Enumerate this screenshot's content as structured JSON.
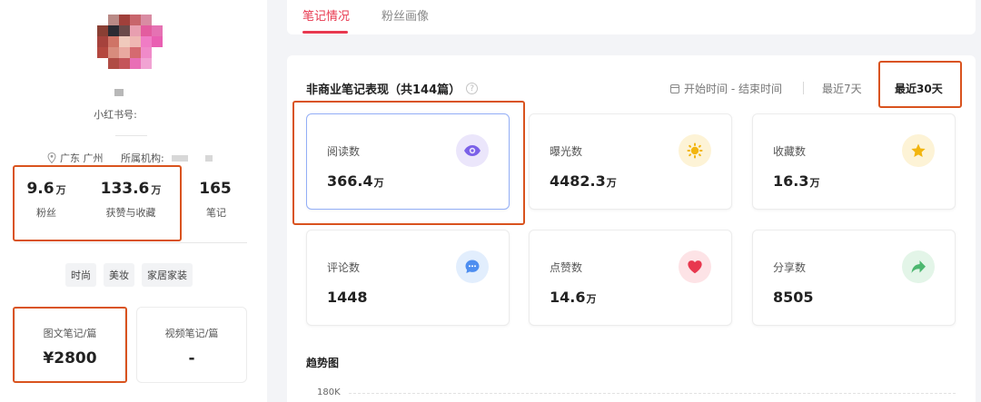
{
  "profile": {
    "red_id_label": "小红书号:",
    "location": "广东 广州",
    "org_label": "所属机构:",
    "stats": [
      {
        "value": "9.6",
        "unit": "万",
        "label": "粉丝"
      },
      {
        "value": "133.6",
        "unit": "万",
        "label": "获赞与收藏"
      },
      {
        "value": "165",
        "unit": "",
        "label": "笔记"
      }
    ],
    "tags": [
      "时尚",
      "美妆",
      "家居家装"
    ],
    "prices": [
      {
        "label": "图文笔记/篇",
        "value": "¥2800"
      },
      {
        "label": "视频笔记/篇",
        "value": "-"
      }
    ]
  },
  "tabs": [
    {
      "label": "笔记情况",
      "active": true
    },
    {
      "label": "粉丝画像",
      "active": false
    }
  ],
  "section": {
    "title": "非商业笔记表现（共144篇）",
    "help_icon": "question-icon",
    "date_range": "开始时间 - 结束时间",
    "ranges": [
      {
        "label": "最近7天",
        "active": false
      },
      {
        "label": "最近30天",
        "active": true
      }
    ]
  },
  "metrics": [
    {
      "label": "阅读数",
      "value": "366.4",
      "unit": "万",
      "icon": "eye-icon",
      "icon_color": "#7b61e8",
      "icon_bg": "#ebe6fb"
    },
    {
      "label": "曝光数",
      "value": "4482.3",
      "unit": "万",
      "icon": "sun-icon",
      "icon_color": "#f2b50f",
      "icon_bg": "#fdf3d6"
    },
    {
      "label": "收藏数",
      "value": "16.3",
      "unit": "万",
      "icon": "star-icon",
      "icon_color": "#f2b50f",
      "icon_bg": "#fdf3d6"
    },
    {
      "label": "评论数",
      "value": "1448",
      "unit": "",
      "icon": "comment-icon",
      "icon_color": "#4e8ef0",
      "icon_bg": "#e2eefd"
    },
    {
      "label": "点赞数",
      "value": "14.6",
      "unit": "万",
      "icon": "heart-icon",
      "icon_color": "#e8384f",
      "icon_bg": "#fde3e6"
    },
    {
      "label": "分享数",
      "value": "8505",
      "unit": "",
      "icon": "share-icon",
      "icon_color": "#4cb76f",
      "icon_bg": "#e3f5e8"
    }
  ],
  "trend": {
    "title": "趋势图",
    "y_tick": "180K"
  },
  "colors": {
    "accent": "#e8384f",
    "highlight_box": "#d9531e",
    "selected_card_border": "#93aef7"
  }
}
